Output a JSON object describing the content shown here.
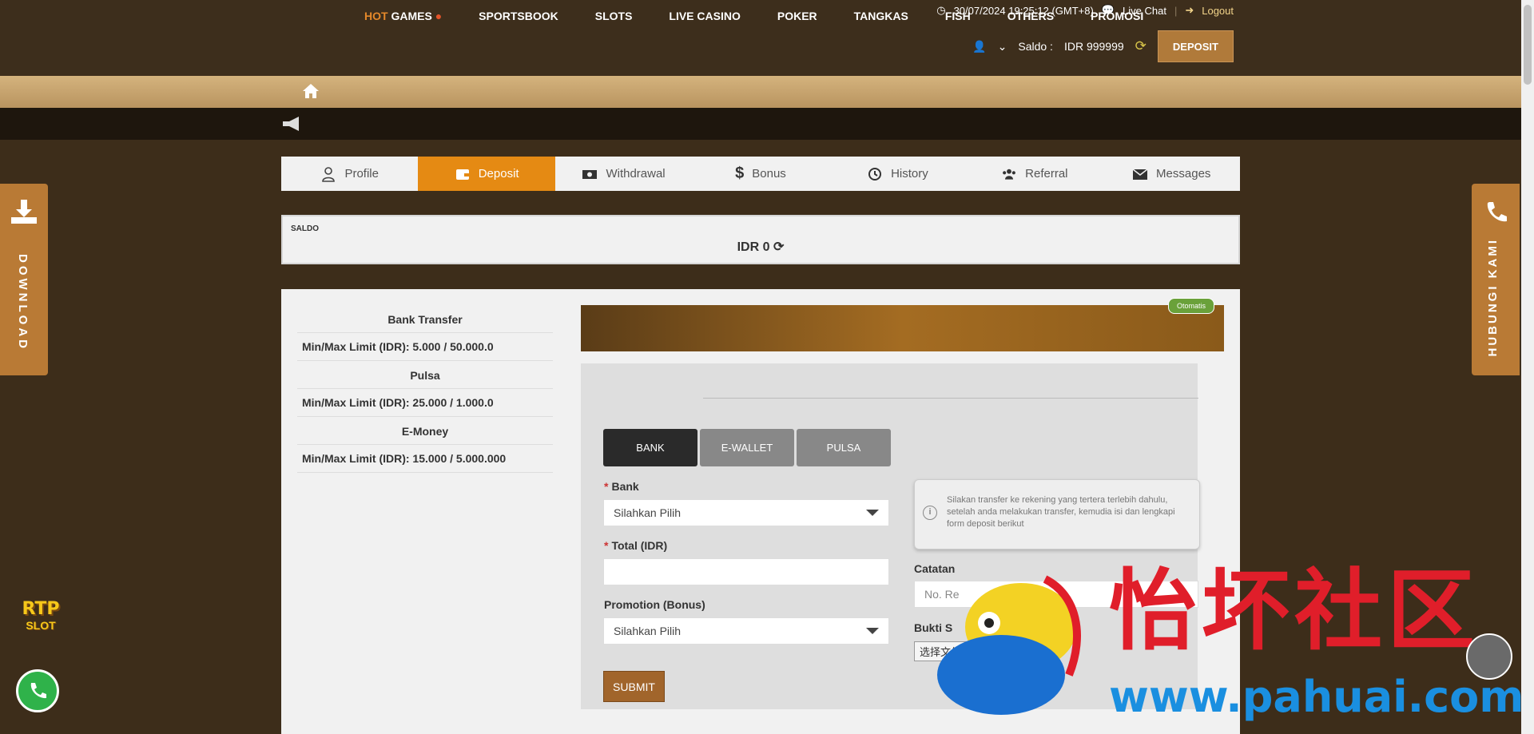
{
  "header": {
    "datetime": "30/07/2024 19:25:12 (GMT+8)",
    "live_chat": "Live Chat",
    "logout": "Logout",
    "saldo_label": "Saldo :",
    "saldo_value": "IDR 999999",
    "deposit_button": "DEPOSIT"
  },
  "nav": {
    "items": [
      "HOT",
      "GAMES",
      "SPORTSBOOK",
      "SLOTS",
      "LIVE CASINO",
      "POKER",
      "TANGKAS",
      "FISH",
      "OTHERS",
      "PROMOSI"
    ]
  },
  "tabs": [
    {
      "label": "Profile",
      "icon": "user-icon"
    },
    {
      "label": "Deposit",
      "icon": "wallet-icon"
    },
    {
      "label": "Withdrawal",
      "icon": "money-icon"
    },
    {
      "label": "Bonus",
      "icon": "dollar-icon"
    },
    {
      "label": "History",
      "icon": "history-icon"
    },
    {
      "label": "Referral",
      "icon": "users-icon"
    },
    {
      "label": "Messages",
      "icon": "envelope-icon"
    }
  ],
  "saldo": {
    "label": "SALDO",
    "value": "IDR 0"
  },
  "limits": [
    {
      "title": "Bank Transfer",
      "row": "Min/Max Limit (IDR):  5.000 / 50.000.0"
    },
    {
      "title": "Pulsa",
      "row": "Min/Max Limit (IDR):  25.000 / 1.000.0"
    },
    {
      "title": "E-Money",
      "row": "Min/Max Limit (IDR):  15.000 / 5.000.000"
    }
  ],
  "auto_badge": "Otomatis",
  "method_tabs": [
    "BANK",
    "E-WALLET",
    "PULSA"
  ],
  "form": {
    "bank_label": "Bank",
    "bank_value": "Silahkan Pilih",
    "total_label": "Total (IDR)",
    "total_value": "",
    "promo_label": "Promotion (Bonus)",
    "promo_value": "Silahkan Pilih",
    "submit": "SUBMIT",
    "info": "Silakan transfer ke rekening yang tertera terlebih dahulu, setelah anda melakukan transfer, kemudia isi dan lengkapi form deposit berikut",
    "catatan_label": "Catatan",
    "catatan_placeholder": "No. Re",
    "bukti_label": "Bukti S",
    "file_button": "选择文件"
  },
  "side": {
    "download": "DOWNLOAD",
    "contact": "HUBUNGI KAMI"
  },
  "rtp": {
    "title": "RTP",
    "sub": "SLOT"
  },
  "watermark": {
    "cn": "怡坏社区",
    "url": "www.pahuai.com"
  },
  "colors": {
    "accent": "#e58a13",
    "brown": "#3d2d1a",
    "gold": "#b97a35"
  }
}
